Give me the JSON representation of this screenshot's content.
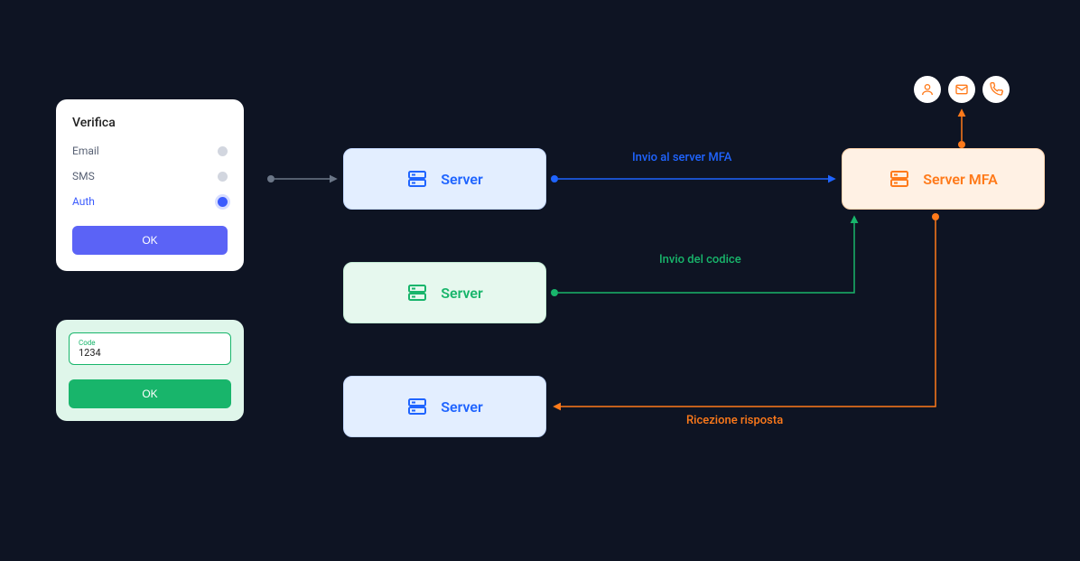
{
  "verify": {
    "title": "Verifica",
    "options": {
      "email": "Email",
      "sms": "SMS",
      "auth": "Auth"
    },
    "ok": "OK"
  },
  "code": {
    "label": "Code",
    "value": "1234",
    "ok": "OK"
  },
  "servers": {
    "s1": "Server",
    "s2": "Server",
    "s3": "Server",
    "mfa": "Server MFA"
  },
  "flows": {
    "to_mfa": "Invio al server MFA",
    "send_code": "Invio del codice",
    "receive": "Ricezione risposta"
  },
  "colors": {
    "blue": "#1f64ff",
    "green": "#18b56b",
    "orange": "#ff7a1a",
    "muted": "#6b7687"
  }
}
